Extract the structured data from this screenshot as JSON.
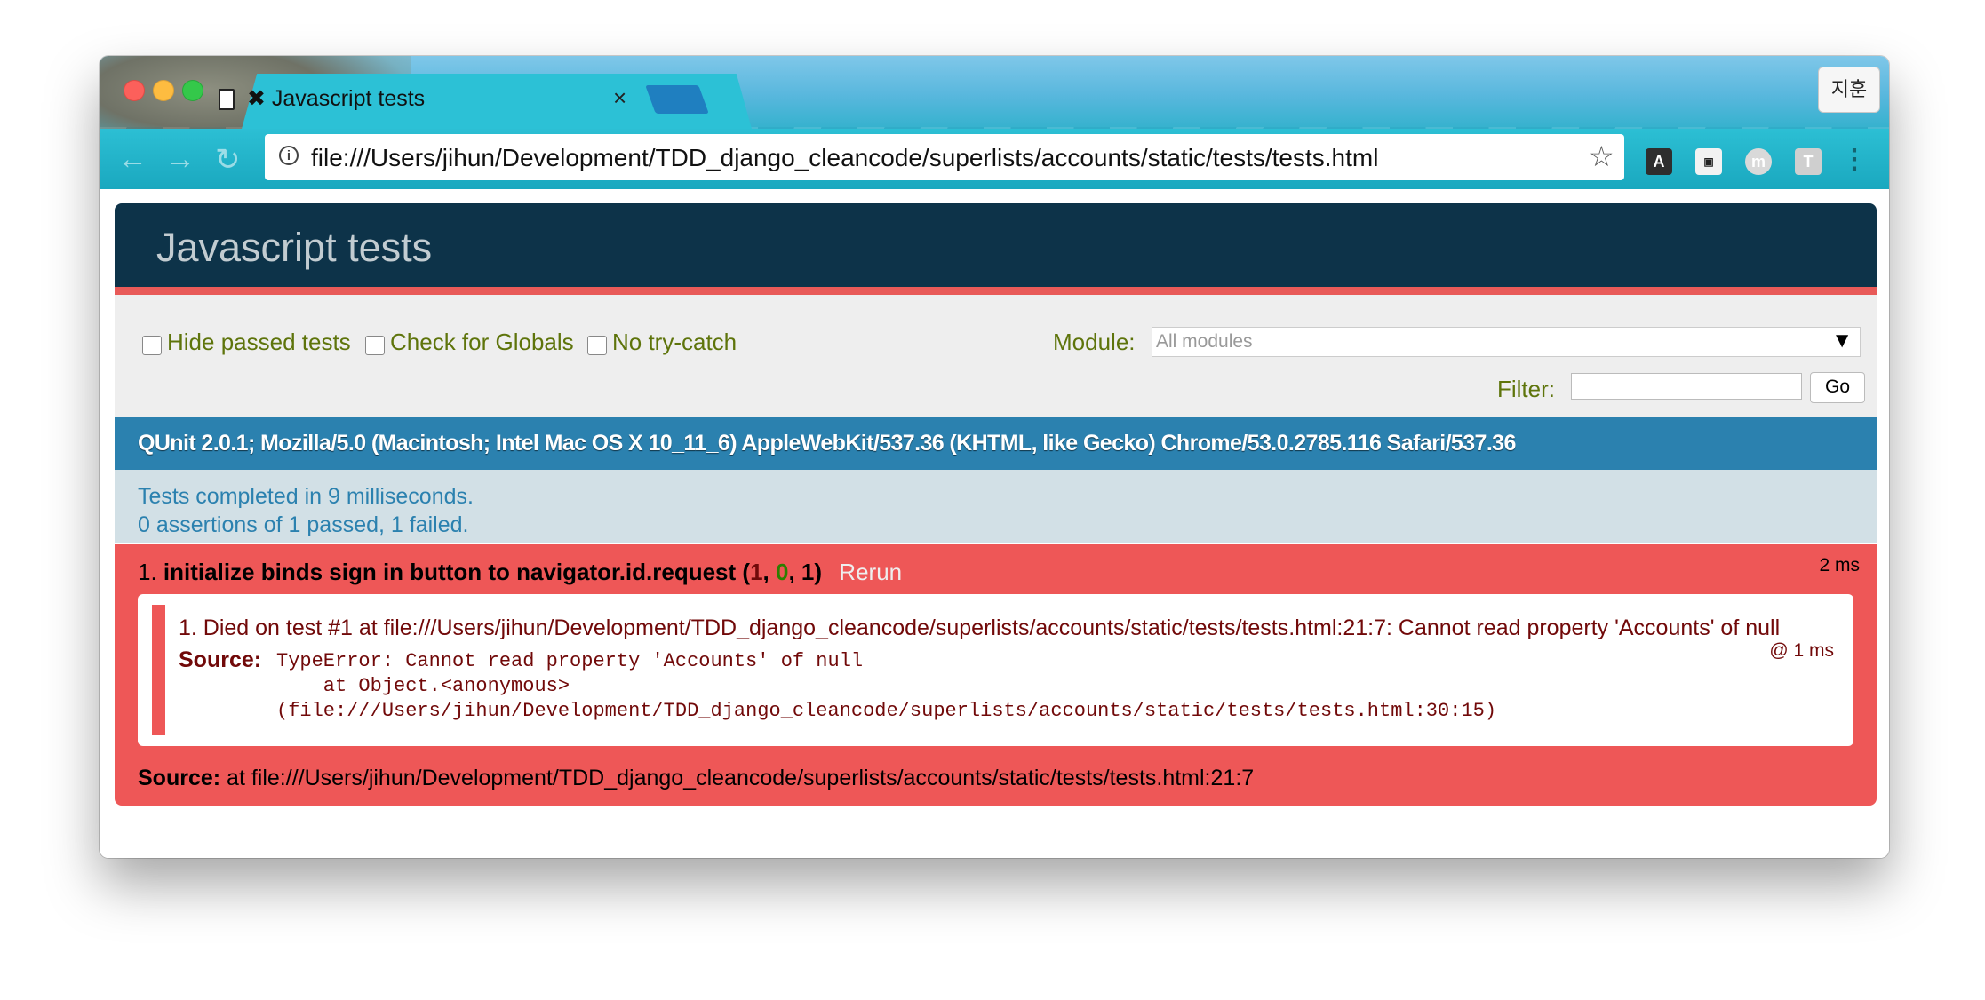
{
  "browser": {
    "tab_title": "✖ Javascript tests",
    "tab_close": "×",
    "profile_label": "지훈",
    "url": "file:///Users/jihun/Development/TDD_django_cleancode/superlists/accounts/static/tests/tests.html",
    "nav": {
      "back": "←",
      "forward": "→",
      "reload": "↻"
    },
    "info_glyph": "i",
    "star_glyph": "☆",
    "extensions": [
      "A",
      "▣",
      "m",
      "T",
      "⋮"
    ]
  },
  "qunit": {
    "header": "Javascript tests",
    "toolbar": {
      "hide_passed": "Hide passed tests",
      "check_globals": "Check for Globals",
      "no_try_catch": "No try-catch",
      "module_label": "Module:",
      "module_value": "All modules",
      "module_arrow": "▼",
      "filter_label": "Filter:",
      "filter_value": "",
      "go_label": "Go"
    },
    "user_agent": "QUnit 2.0.1; Mozilla/5.0 (Macintosh; Intel Mac OS X 10_11_6) AppleWebKit/537.36 (KHTML, like Gecko) Chrome/53.0.2785.116 Safari/537.36",
    "stats": {
      "line1": "Tests completed in 9 milliseconds.",
      "line2": "0 assertions of 1 passed, 1 failed."
    },
    "test": {
      "number": "1.",
      "name": "initialize binds sign in button to navigator.id.request",
      "failed": "1",
      "passed": "0",
      "total": "1",
      "rerun": "Rerun",
      "runtime": "2 ms",
      "assertion": {
        "message": "1. Died on test #1     at file:///Users/jihun/Development/TDD_django_cleancode/superlists/accounts/static/tests/tests.html:21:7: Cannot read property 'Accounts' of null",
        "time": "@ 1 ms",
        "source_label": "Source:",
        "source": "TypeError: Cannot read property 'Accounts' of null\n    at Object.<anonymous>\n(file:///Users/jihun/Development/TDD_django_cleancode/superlists/accounts/static/tests/tests.html:30:15)"
      },
      "source_label": "Source:",
      "source": "at file:///Users/jihun/Development/TDD_django_cleancode/superlists/accounts/static/tests/tests.html:21:7"
    }
  },
  "colors": {
    "header_bg": "#0d3349",
    "header_text": "#c2ccd1",
    "fail_red": "#ee5757",
    "ua_bar": "#2b81af",
    "toolbar_text": "#5e740b",
    "fail_text": "#710909",
    "pass_green": "#2d7e00"
  }
}
